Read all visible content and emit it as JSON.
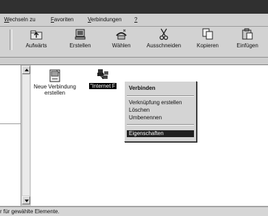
{
  "menubar": {
    "items": [
      {
        "label": "Wechseln zu",
        "underline": "W"
      },
      {
        "label": "Favoriten",
        "underline": "F"
      },
      {
        "label": "Verbindungen",
        "underline": "V"
      },
      {
        "label": "?",
        "underline": "?"
      }
    ]
  },
  "toolbar": {
    "buttons": [
      {
        "label": "Aufwärts",
        "icon": "folder-up-icon"
      },
      {
        "label": "Erstellen",
        "icon": "new-connection-icon"
      },
      {
        "label": "Wählen",
        "icon": "dial-icon"
      },
      {
        "label": "Ausschneiden",
        "icon": "scissors-icon"
      },
      {
        "label": "Kopieren",
        "icon": "copy-icon"
      },
      {
        "label": "Einfügen",
        "icon": "paste-icon"
      }
    ]
  },
  "content": {
    "items": [
      {
        "label_line1": "Neue Verbindung",
        "label_line2": "erstellen",
        "icon": "new-connection-wizard-icon",
        "selected": false
      },
      {
        "label_line1": "\"Internet F",
        "icon": "dialup-connection-icon",
        "selected": true
      }
    ]
  },
  "context_menu": {
    "items": [
      {
        "label": "Verbinden",
        "default": true,
        "highlighted": false
      },
      {
        "label": "Verknüpfung erstellen",
        "default": false,
        "highlighted": false
      },
      {
        "label": "Löschen",
        "default": false,
        "highlighted": false
      },
      {
        "label": "Umbenennen",
        "default": false,
        "highlighted": false
      },
      {
        "label": "Eigenschaften",
        "default": false,
        "highlighted": true
      }
    ]
  },
  "statusbar": {
    "text": "r für gewählte Elemente."
  }
}
